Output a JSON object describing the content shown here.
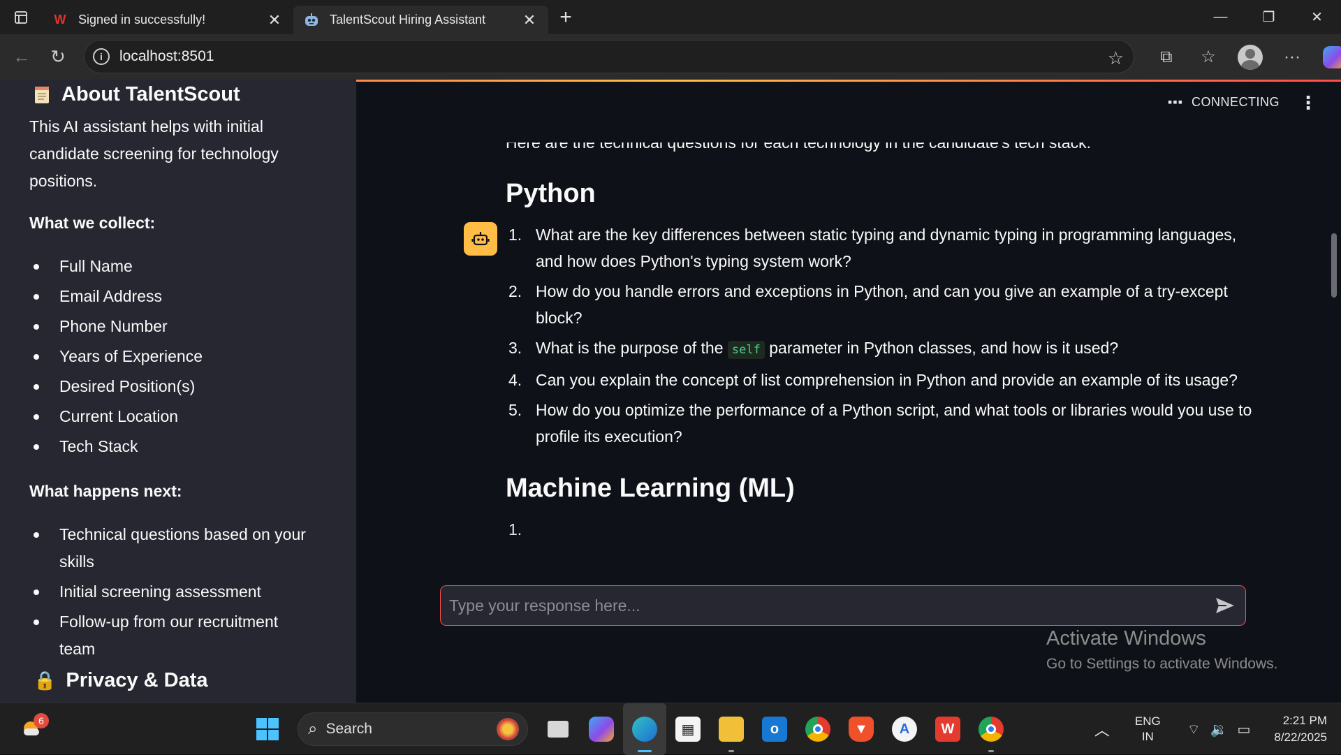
{
  "browser": {
    "tabs": [
      {
        "title": "Signed in successfully!",
        "favicon": "wps-icon",
        "active": false
      },
      {
        "title": "TalentScout Hiring Assistant",
        "favicon": "robot-icon",
        "active": true
      }
    ],
    "url": "localhost:8501"
  },
  "sidebar": {
    "about_title": "About TalentScout",
    "about_text": "This AI assistant helps with initial candidate screening for technology positions.",
    "collect_heading": "What we collect:",
    "collect_items": [
      "Full Name",
      "Email Address",
      "Phone Number",
      "Years of Experience",
      "Desired Position(s)",
      "Current Location",
      "Tech Stack"
    ],
    "next_heading": "What happens next:",
    "next_items": [
      "Technical questions based on your skills",
      "Initial screening assessment",
      "Follow-up from our recruitment team"
    ],
    "privacy_title": "Privacy & Data"
  },
  "status": {
    "text": "CONNECTING"
  },
  "chat": {
    "intro": "Here are the technical questions for each technology in the candidate's tech stack:",
    "section1": "Python",
    "questions": [
      {
        "num": "1.",
        "text": "What are the key differences between static typing and dynamic typing in programming languages, and how does Python's typing system work?"
      },
      {
        "num": "2.",
        "text": "How do you handle errors and exceptions in Python, and can you give an example of a try-except block?"
      },
      {
        "num": "3.",
        "before": "What is the purpose of the ",
        "code": "self",
        "after": " parameter in Python classes, and how is it used?"
      },
      {
        "num": "4.",
        "text": "Can you explain the concept of list comprehension in Python and provide an example of its usage?"
      },
      {
        "num": "5.",
        "text": "How do you optimize the performance of a Python script, and what tools or libraries would you use to profile its execution?"
      }
    ],
    "section2": "Machine Learning (ML)",
    "cut_num": "1."
  },
  "input": {
    "placeholder": "Type your response here..."
  },
  "watermark": {
    "line1": "Activate Windows",
    "line2": "Go to Settings to activate Windows."
  },
  "taskbar": {
    "weather_badge": "6",
    "search_label": "Search",
    "lang_line1": "ENG",
    "lang_line2": "IN",
    "time": "2:21 PM",
    "date": "8/22/2025"
  },
  "colors": {
    "accent": "#ff4b4b",
    "bot_avatar": "#ffbd45",
    "sidebar_bg": "#262730",
    "main_bg": "#0e1117"
  }
}
